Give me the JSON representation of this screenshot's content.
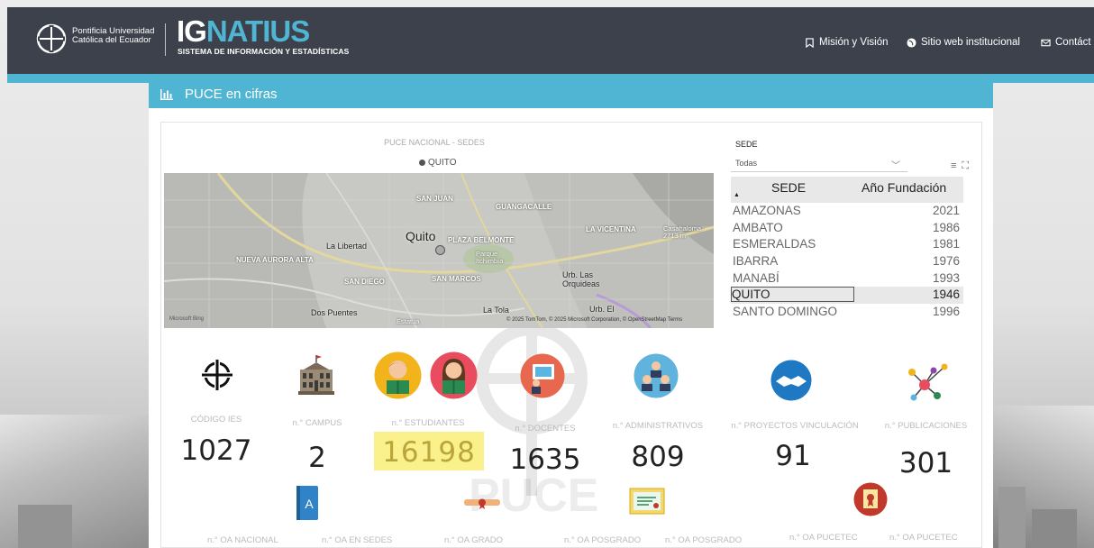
{
  "header": {
    "university": "Pontificia Universidad Católica del Ecuador",
    "brand_ig": "IG",
    "brand_rest": "NATIUS",
    "brand_sub": "SISTEMA DE INFORMACIÓN Y ESTADÍSTICAS",
    "nav": [
      {
        "label": "Misión y Visión",
        "icon": "bookmark-icon"
      },
      {
        "label": "Sitio web institucional",
        "icon": "globe-icon"
      },
      {
        "label": "Contáct",
        "icon": "mail-icon"
      }
    ]
  },
  "panel": {
    "title": "PUCE en cifras",
    "icon": "bar-chart-icon"
  },
  "map": {
    "title": "PUCE NACIONAL - SEDES",
    "legend": "QUITO",
    "city_label": "Quito",
    "labels": [
      "SAN JUAN",
      "GUANGACALLE",
      "LA VICENTINA",
      "Casahaloma 2713 m",
      "La Libertad",
      "PLAZA BELMONTE",
      "NUEVA AURORA ALTA",
      "Parque Itchimbía",
      "SAN DIEGO",
      "SAN MARCOS",
      "Urb. Las Orquideas",
      "Dos Puentes",
      "Estatua",
      "La Tola",
      "Urb. El"
    ],
    "attribution": "© 2025 TomTom, © 2025 Microsoft Corporation, © OpenStreetMap  Terms",
    "bing": "Microsoft Bing"
  },
  "slicer": {
    "label": "SEDE",
    "selected": "Todas"
  },
  "table": {
    "headers": [
      "SEDE",
      "Año Fundación"
    ],
    "rows": [
      {
        "sede": "AMAZONAS",
        "year": "2021"
      },
      {
        "sede": "AMBATO",
        "year": "1986"
      },
      {
        "sede": "ESMERALDAS",
        "year": "1981"
      },
      {
        "sede": "IBARRA",
        "year": "1976"
      },
      {
        "sede": "MANABÍ",
        "year": "1993"
      },
      {
        "sede": "QUITO",
        "year": "1946"
      },
      {
        "sede": "SANTO DOMINGO",
        "year": "1996"
      }
    ]
  },
  "kpis": [
    {
      "label": "CÓDIGO IES",
      "value": "1027",
      "icon": "compass-icon"
    },
    {
      "label": "n.° CAMPUS",
      "value": "2",
      "icon": "building-icon"
    },
    {
      "label": "n.° ESTUDIANTES",
      "value": "16198",
      "icon": "students-icon"
    },
    {
      "label": "n.° DOCENTES",
      "value": "1635",
      "icon": "teacher-board-icon"
    },
    {
      "label": "n.° ADMINISTRATIVOS",
      "value": "809",
      "icon": "staff-icon"
    },
    {
      "label": "n.° PROYECTOS VINCULACIÓN",
      "value": "91",
      "icon": "handshake-icon"
    },
    {
      "label": "n.° PUBLICACIONES",
      "value": "301",
      "icon": "network-icon"
    }
  ],
  "oa_labels": [
    "n.° OA NACIONAL",
    "n.° OA EN SEDES",
    "n.° OA GRADO",
    "n.° OA POSGRADO",
    "n.° OA POSGRADO",
    "n.° OA PUCETEC",
    "n.° OA PUCETEC"
  ],
  "watermark": "PUCE"
}
